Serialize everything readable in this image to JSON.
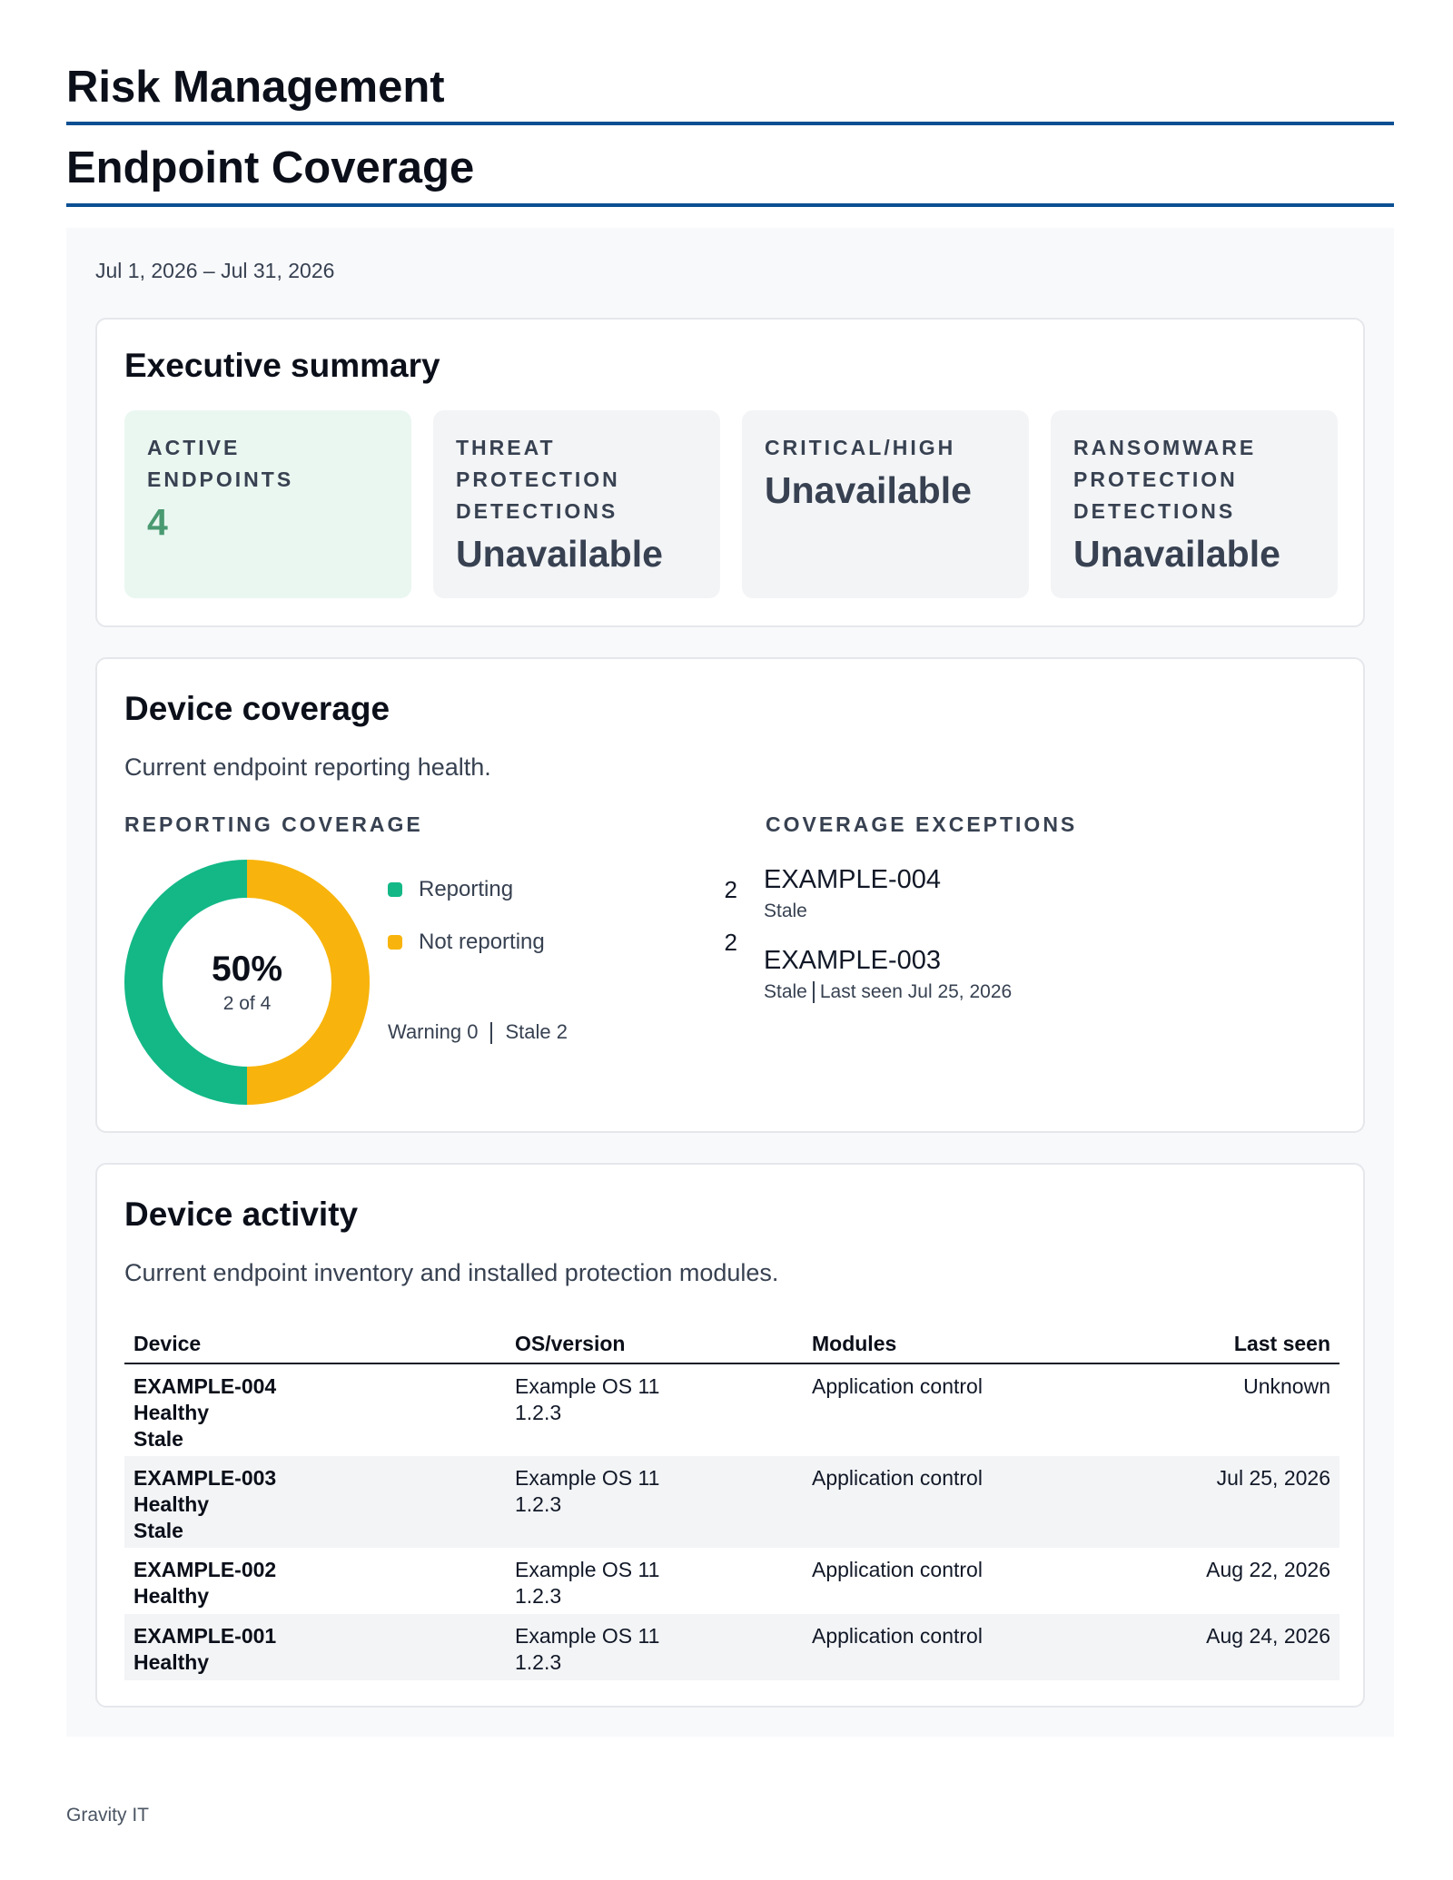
{
  "header": {
    "title": "Risk Management",
    "section": "Endpoint Coverage"
  },
  "report": {
    "date_range": "Jul 1, 2026 – Jul 31, 2026"
  },
  "executive_summary": {
    "title": "Executive summary",
    "kpis": [
      {
        "label_lines": [
          "ACTIVE",
          "ENDPOINTS"
        ],
        "value": "4",
        "accent": "#4a9a71"
      },
      {
        "label_lines": [
          "THREAT",
          "PROTECTION",
          "DETECTIONS"
        ],
        "value": "Unavailable"
      },
      {
        "label_lines": [
          "CRITICAL/HIGH"
        ],
        "value": "Unavailable"
      },
      {
        "label_lines": [
          "RANSOMWARE",
          "PROTECTION",
          "DETECTIONS"
        ],
        "value": "Unavailable"
      }
    ]
  },
  "device_coverage": {
    "title": "Device coverage",
    "description": "Current endpoint reporting health.",
    "reporting_label": "REPORTING COVERAGE",
    "exceptions_label": "COVERAGE EXCEPTIONS",
    "donut": {
      "percent_text": "50%",
      "sub_text": "2 of 4"
    },
    "legend": [
      {
        "label": "Reporting",
        "count": "2",
        "color": "#13b886"
      },
      {
        "label": "Not reporting",
        "count": "2",
        "color": "#f8b40c"
      }
    ],
    "footer": {
      "warning": "Warning 0",
      "stale": "Stale 2"
    },
    "exceptions": [
      {
        "name": "EXAMPLE-004",
        "status": "Stale",
        "last_seen": ""
      },
      {
        "name": "EXAMPLE-003",
        "status": "Stale",
        "last_seen": "Last seen Jul 25, 2026"
      }
    ]
  },
  "chart_data": {
    "type": "pie",
    "categories": [
      "Reporting",
      "Not reporting"
    ],
    "values": [
      2,
      2
    ],
    "colors": [
      "#13b886",
      "#f8b40c"
    ],
    "title": "REPORTING COVERAGE"
  },
  "device_activity": {
    "title": "Device activity",
    "description": "Current endpoint inventory and installed protection modules.",
    "columns": {
      "device": "Device",
      "os": "OS/version",
      "modules": "Modules",
      "last_seen": "Last seen"
    },
    "rows": [
      {
        "name": "EXAMPLE-004",
        "statuses": [
          "Healthy",
          "Stale"
        ],
        "os": "Example OS 11",
        "version": "1.2.3",
        "modules": "Application control",
        "last_seen": "Unknown"
      },
      {
        "name": "EXAMPLE-003",
        "statuses": [
          "Healthy",
          "Stale"
        ],
        "os": "Example OS 11",
        "version": "1.2.3",
        "modules": "Application control",
        "last_seen": "Jul 25, 2026"
      },
      {
        "name": "EXAMPLE-002",
        "statuses": [
          "Healthy"
        ],
        "os": "Example OS 11",
        "version": "1.2.3",
        "modules": "Application control",
        "last_seen": "Aug 22, 2026"
      },
      {
        "name": "EXAMPLE-001",
        "statuses": [
          "Healthy"
        ],
        "os": "Example OS 11",
        "version": "1.2.3",
        "modules": "Application control",
        "last_seen": "Aug 24, 2026"
      }
    ]
  },
  "footer": {
    "brand": "Gravity IT"
  }
}
